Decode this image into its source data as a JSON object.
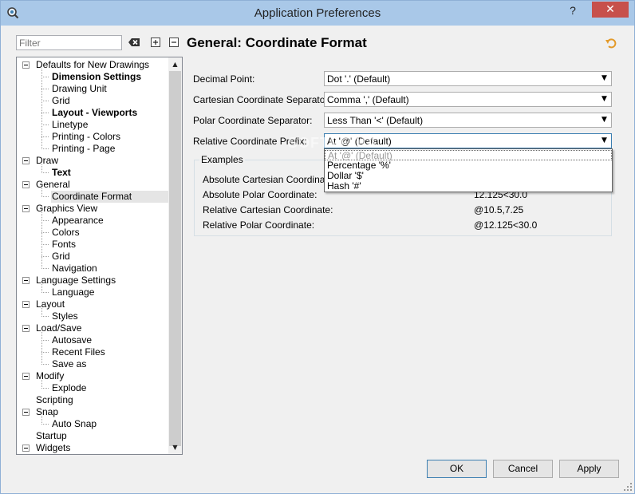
{
  "window": {
    "title": "Application Preferences",
    "help_label": "?",
    "close_label": "✕"
  },
  "filter": {
    "placeholder": "Filter",
    "value": ""
  },
  "tree": [
    {
      "label": "Defaults for New Drawings",
      "level": 0,
      "expanded": true
    },
    {
      "label": "Dimension Settings",
      "level": 1,
      "bold": true
    },
    {
      "label": "Drawing Unit",
      "level": 1
    },
    {
      "label": "Grid",
      "level": 1
    },
    {
      "label": "Layout - Viewports",
      "level": 1,
      "bold": true
    },
    {
      "label": "Linetype",
      "level": 1
    },
    {
      "label": "Printing - Colors",
      "level": 1
    },
    {
      "label": "Printing - Page",
      "level": 1
    },
    {
      "label": "Draw",
      "level": 0,
      "expanded": true
    },
    {
      "label": "Text",
      "level": 1,
      "bold": true
    },
    {
      "label": "General",
      "level": 0,
      "expanded": true
    },
    {
      "label": "Coordinate Format",
      "level": 1,
      "selected": true
    },
    {
      "label": "Graphics View",
      "level": 0,
      "expanded": true
    },
    {
      "label": "Appearance",
      "level": 1
    },
    {
      "label": "Colors",
      "level": 1
    },
    {
      "label": "Fonts",
      "level": 1
    },
    {
      "label": "Grid",
      "level": 1
    },
    {
      "label": "Navigation",
      "level": 1
    },
    {
      "label": "Language Settings",
      "level": 0,
      "expanded": true
    },
    {
      "label": "Language",
      "level": 1
    },
    {
      "label": "Layout",
      "level": 0,
      "expanded": true
    },
    {
      "label": "Styles",
      "level": 1
    },
    {
      "label": "Load/Save",
      "level": 0,
      "expanded": true
    },
    {
      "label": "Autosave",
      "level": 1
    },
    {
      "label": "Recent Files",
      "level": 1
    },
    {
      "label": "Save as",
      "level": 1
    },
    {
      "label": "Modify",
      "level": 0,
      "expanded": true
    },
    {
      "label": "Explode",
      "level": 1
    },
    {
      "label": "Scripting",
      "level": 0
    },
    {
      "label": "Snap",
      "level": 0,
      "expanded": true
    },
    {
      "label": "Auto Snap",
      "level": 1
    },
    {
      "label": "Startup",
      "level": 0
    },
    {
      "label": "Widgets",
      "level": 0,
      "expanded": true
    }
  ],
  "page": {
    "title": "General: Coordinate Format"
  },
  "form": {
    "decimal_point": {
      "label": "Decimal Point:",
      "value": "Dot '.' (Default)"
    },
    "cartesian_sep": {
      "label": "Cartesian Coordinate Separator:",
      "value": "Comma ',' (Default)"
    },
    "polar_sep": {
      "label": "Polar Coordinate Separator:",
      "value": "Less Than '<' (Default)"
    },
    "relative_prefix": {
      "label": "Relative Coordinate Prefix:",
      "value": "At '@' (Default)"
    }
  },
  "dropdown": {
    "options": [
      "At '@' (Default)",
      "Percentage '%'",
      "Dollar '$'",
      "Hash '#'"
    ]
  },
  "examples": {
    "title": "Examples",
    "rows": [
      {
        "label": "Absolute Cartesian Coordinate:",
        "value": ""
      },
      {
        "label": "Absolute Polar Coordinate:",
        "value": "12.125<30.0"
      },
      {
        "label": "Relative Cartesian Coordinate:",
        "value": "@10.5,7.25"
      },
      {
        "label": "Relative Polar Coordinate:",
        "value": "@12.125<30.0"
      }
    ]
  },
  "buttons": {
    "ok": "OK",
    "cancel": "Cancel",
    "apply": "Apply"
  },
  "watermark": "SOFTPEDIA",
  "colors": {
    "titlebar": "#a9c8e8",
    "close": "#c7504b",
    "accent": "#3c7fb1",
    "selection": "#e5e5e5"
  },
  "icons": {
    "app": "app-icon",
    "clear": "clear-filter-icon",
    "expand_all": "expand-all-icon",
    "collapse_all": "collapse-all-icon",
    "undo": "undo-icon"
  }
}
